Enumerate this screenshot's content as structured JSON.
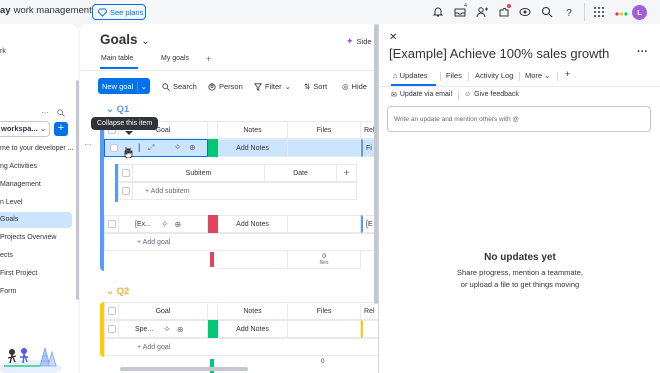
{
  "topbar": {
    "brand_prefix": "ay",
    "brand_suffix": "work management",
    "see_plans": "See plans",
    "inbox_badge": "4",
    "avatar_letter": "L",
    "accent": "#0073ea"
  },
  "sidebar": {
    "item_work": "rk",
    "workspace_name": "workspa...",
    "items": [
      "me to your developer ...",
      "ng Activities",
      "Management",
      "n Level",
      "Goals",
      "Projects Overview",
      "ects",
      "First Project",
      " Form"
    ]
  },
  "board": {
    "title": "Goals",
    "sidekick": "Side",
    "views": [
      "Main table",
      "My goals"
    ],
    "toolbar": {
      "new_item": "New goal",
      "search": "Search",
      "person": "Person",
      "filter": "Filter",
      "sort": "Sort",
      "hide": "Hide"
    },
    "tooltip": "Collapse this item",
    "groups": [
      {
        "name": "Q1",
        "color": "#579bfc",
        "columns": {
          "goal": "Goal",
          "notes": "Notes",
          "files": "Files",
          "rel": "Rel"
        },
        "rows": [
          {
            "name": "",
            "status_color": "#00c875",
            "notes": "Add Notes",
            "files": "Fi"
          },
          {
            "name": "[Ex...",
            "status_color": "#e2445c",
            "notes": "Add Notes",
            "files": "[E"
          }
        ],
        "subitems": {
          "col_subitem": "Subitem",
          "col_date": "Date",
          "add": "+ Add subitem"
        },
        "add_item": "+ Add goal",
        "summary_files": "0",
        "summary_files_label": "files"
      },
      {
        "name": "Q2",
        "color": "#ffcb00",
        "columns": {
          "goal": "Goal",
          "notes": "Notes",
          "files": "Files",
          "rel": "Rel"
        },
        "rows": [
          {
            "name": "Spe...",
            "status_color": "#00c875",
            "notes": "Add Notes",
            "files": ""
          }
        ],
        "add_item": "+ Add goal",
        "summary_files": "0"
      }
    ]
  },
  "panel": {
    "title": "[Example] Achieve 100% sales growth",
    "tabs": [
      "Updates",
      "Files",
      "Activity Log",
      "More"
    ],
    "update_via_email": "Update via email",
    "give_feedback": "Give feedback",
    "placeholder": "Write an update and mention others with @",
    "empty_title": "No updates yet",
    "empty_line1": "Share progress, mention a teammate,",
    "empty_line2": "or upload a file to get things moving"
  }
}
